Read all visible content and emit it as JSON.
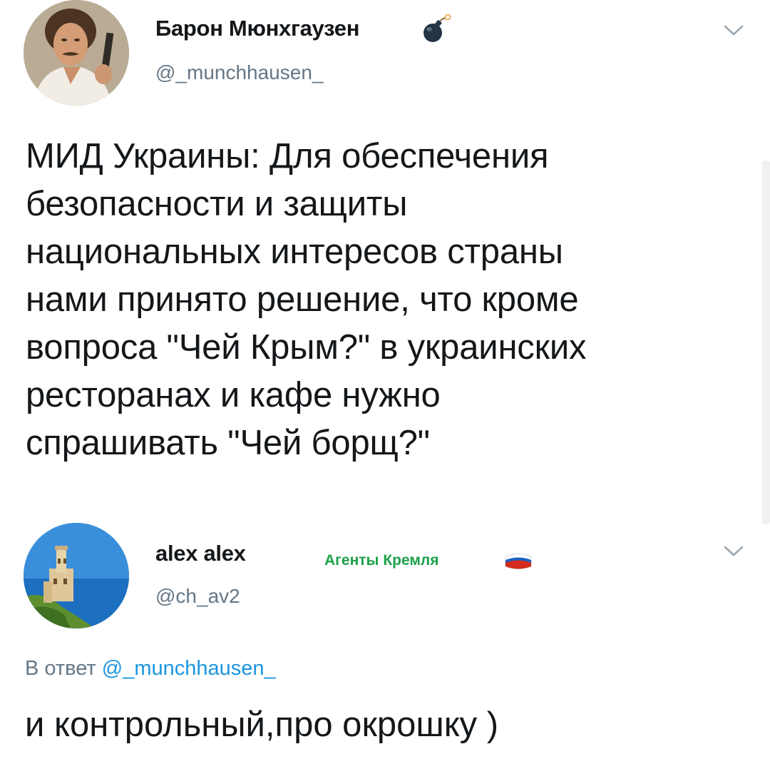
{
  "tweet": {
    "author_name": "Барон Мюнхгаузен",
    "author_handle": "@_munchhausen_",
    "text": "МИД Украины: Для обеспечения\nбезопасности и защиты\nнациональных интересов страны\nнами принято решение, что кроме\nвопроса \"Чей Крым?\" в украинских\nресторанах и кафе нужно\nспрашивать \"Чей борщ?\"",
    "name_icon": "bomb-icon",
    "menu_icon": "chevron-down-icon"
  },
  "reply": {
    "author_name": "alex alex",
    "author_handle": "@ch_av2",
    "badge_label": "Агенты Кремля",
    "badge_icon": "russian-flag-icon",
    "reply_prefix": "В ответ",
    "reply_mention": "@_munchhausen_",
    "text": "и контрольный,про окрошку )",
    "menu_icon": "chevron-down-icon"
  },
  "colors": {
    "text": "#14171a",
    "secondary": "#657786",
    "mention": "#1b95e0",
    "badge_green": "#1da14a"
  }
}
